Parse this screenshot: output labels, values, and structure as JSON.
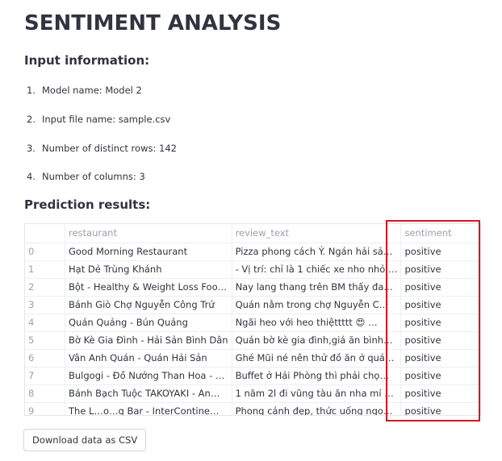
{
  "page": {
    "title": "SENTIMENT ANALYSIS"
  },
  "input_info": {
    "heading": "Input information:",
    "items": [
      {
        "num": "1.",
        "text": "Model name: Model 2"
      },
      {
        "num": "2.",
        "text": "Input file name: sample.csv"
      },
      {
        "num": "3.",
        "text": "Number of distinct rows: 142"
      },
      {
        "num": "4.",
        "text": "Number of columns: 3"
      }
    ]
  },
  "results": {
    "heading": "Prediction results:",
    "columns": [
      "",
      "restaurant",
      "review_text",
      "sentiment"
    ],
    "rows": [
      {
        "idx": "0",
        "restaurant": "Good Morning Restaurant",
        "review": "Pizza phong cách Ý. Ngán hải sả…",
        "sentiment": "positive"
      },
      {
        "idx": "1",
        "restaurant": "Hạt Dẻ Trùng Khánh",
        "review": "- Vị trí: chỉ là 1 chiếc xe nho nhỏ …",
        "sentiment": "positive"
      },
      {
        "idx": "2",
        "restaurant": "Bột - Healthy & Weight Loss Foo…",
        "review": "Nay lang thang trên BM thấy đa…",
        "sentiment": "positive"
      },
      {
        "idx": "3",
        "restaurant": "Bánh Giò Chợ Nguyễn Công Trứ",
        "review": "Quán nằm trong chợ Nguyễn C…",
        "sentiment": "positive"
      },
      {
        "idx": "4",
        "restaurant": "Quán Quảng - Bún Quảng",
        "review": "Ngãi heo với heo thiệttttt 😍 …",
        "sentiment": "positive"
      },
      {
        "idx": "5",
        "restaurant": "Bờ Kè Gia Đình - Hải Sản Bình Dân",
        "review": "Quán bờ kè gia đình,giá ăn bình…",
        "sentiment": "positive"
      },
      {
        "idx": "6",
        "restaurant": "Vân Anh Quán - Quán Hải Sản",
        "review": "Ghé Mũi né nên thử đồ ăn ở quá…",
        "sentiment": "positive"
      },
      {
        "idx": "7",
        "restaurant": "Bulgogi - Đồ Nướng Than Hoa - …",
        "review": "Buffet ở Hải Phòng thì phải chọ…",
        "sentiment": "positive"
      },
      {
        "idx": "8",
        "restaurant": "Bánh Bạch Tuộc TAKOYAKI - An…",
        "review": "1 năm 2l đi vũng tàu ăn nha mí …",
        "sentiment": "positive"
      },
      {
        "idx": "9",
        "restaurant": "The L…o…g Bar - InterContine…",
        "review": "Phong cảnh đẹp, thức uống ngo…",
        "sentiment": "positive"
      }
    ]
  },
  "download": {
    "label": "Download data as CSV"
  },
  "colors": {
    "highlight": "#d6161d",
    "text": "#31333f",
    "muted": "#9aa0aa"
  }
}
